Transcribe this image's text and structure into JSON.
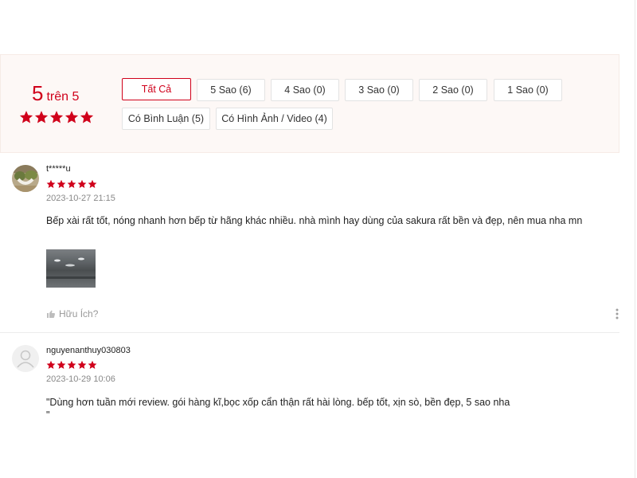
{
  "overview": {
    "score": "5",
    "out_of": "trên 5",
    "rating": 5,
    "filters": [
      {
        "label": "Tất Cả",
        "active": true
      },
      {
        "label": "5 Sao (6)",
        "active": false
      },
      {
        "label": "4 Sao (0)",
        "active": false
      },
      {
        "label": "3 Sao (0)",
        "active": false
      },
      {
        "label": "2 Sao (0)",
        "active": false
      },
      {
        "label": "1 Sao (0)",
        "active": false
      },
      {
        "label": "Có Bình Luận (5)",
        "active": false
      },
      {
        "label": "Có Hình Ảnh / Video (4)",
        "active": false
      }
    ]
  },
  "reviews": [
    {
      "username": "t*****u",
      "rating": 5,
      "timestamp": "2023-10-27 21:15",
      "content": "Bếp xài rất tốt, nóng nhanh hơn bếp từ hãng khác nhiều. nhà mình hay dùng của sakura rất bền và đẹp, nên mua nha mn",
      "helpful_label": "Hữu Ích?"
    },
    {
      "username": "nguyenanthuy030803",
      "rating": 5,
      "timestamp": "2023-10-29 10:06",
      "content": "\"Dùng hơn tuần mới review. gói hàng kĩ,bọc xốp cẩn thận rất hài lòng. bếp tốt, xịn sò, bền đẹp, 5 sao nha",
      "content_line2": "\""
    }
  ],
  "colors": {
    "accent": "#d0011b",
    "panel_bg": "#fdf8f6"
  }
}
